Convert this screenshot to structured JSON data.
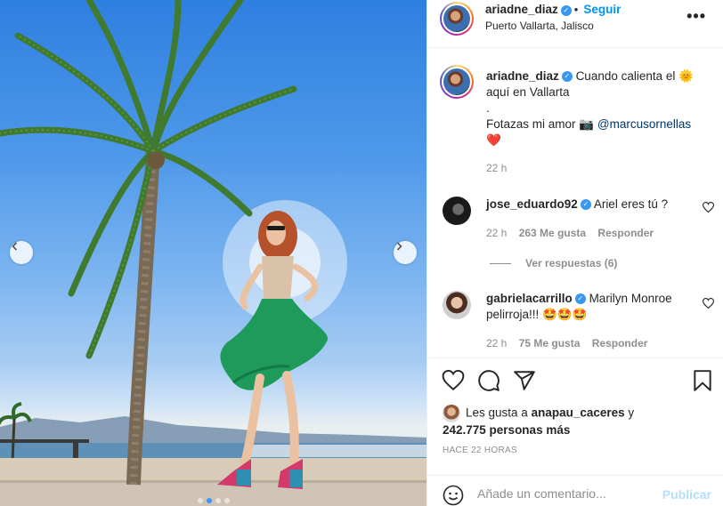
{
  "post": {
    "media": {
      "carousel_dots": 4,
      "active_dot": 1,
      "prev_icon": "chevron-left-icon",
      "next_icon": "chevron-right-icon"
    },
    "header": {
      "username": "ariadne_diaz",
      "verified_icon": "verified-badge-icon",
      "follow_label": "Seguir",
      "location": "Puerto Vallarta, Jalisco",
      "more_icon": "more-options-icon",
      "more_label": "•••"
    },
    "caption": {
      "username": "ariadne_diaz",
      "line1": "Cuando calienta el",
      "sun_emoji": "🌞",
      "line2": "aquí en Vallarta",
      "dot": ".",
      "line3": "Fotazas mi amor",
      "camera_emoji": "📷",
      "mention": "@marcusornellas",
      "heart_emoji": "❤️",
      "time": "22 h"
    },
    "comments": [
      {
        "username": "jose_eduardo92",
        "text": "Ariel eres tú ?",
        "time": "22 h",
        "likes": "263 Me gusta",
        "reply_label": "Responder",
        "view_replies": "Ver respuestas (6)"
      },
      {
        "username": "gabrielacarrillo",
        "text": "Marilyn Monroe pelirroja!!!",
        "emojis": "🤩🤩🤩",
        "time": "22 h",
        "likes": "75 Me gusta",
        "reply_label": "Responder"
      }
    ],
    "actions": {
      "like_icon": "heart-icon",
      "comment_icon": "comment-icon",
      "share_icon": "send-icon",
      "save_icon": "bookmark-icon"
    },
    "likes": {
      "prefix": "Les gusta a",
      "user": "anapau_caceres",
      "joiner": "y",
      "count_text": "242.775 personas más"
    },
    "timestamp": "HACE 22 HORAS",
    "composer": {
      "emoji_icon": "emoji-icon",
      "placeholder": "Añade un comentario...",
      "publish_label": "Publicar"
    },
    "colors": {
      "accent": "#0095f6",
      "verified": "#3897f0",
      "muted": "#8e8e8e",
      "publish_disabled": "#b2dffc",
      "heart_red": "#ed4956"
    }
  }
}
